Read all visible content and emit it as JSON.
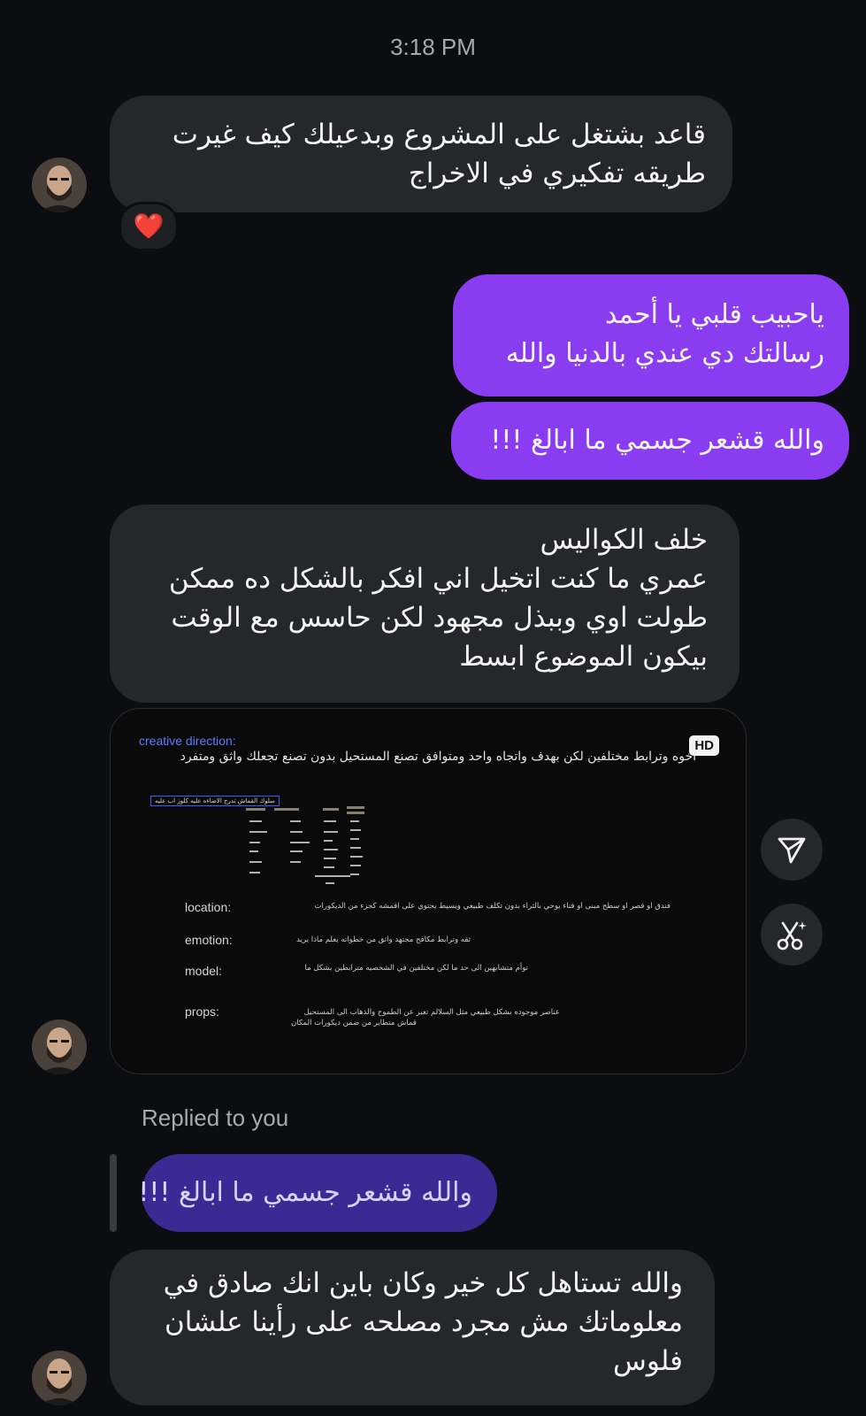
{
  "timestamp": "3:18 PM",
  "messages": [
    {
      "lines": [
        "قاعد بشتغل على المشروع وبدعيلك كيف غيرت",
        "طريقه تفكيري في الاخراج"
      ],
      "reaction": "❤️"
    },
    {
      "lines": [
        "ياحبيب قلبي يا أحمد",
        "رسالتك دي عندي بالدنيا والله"
      ]
    },
    {
      "lines": [
        "والله قشعر جسمي ما ابالغ !!!"
      ]
    },
    {
      "lines": [
        "خلف الكواليس",
        "عمري ما كنت اتخيل اني افكر بالشكل ده ممكن",
        "طولت اوي وببذل مجهود لكن حاسس مع الوقت",
        "بيكون الموضوع ابسط"
      ]
    },
    {
      "lines": [
        "والله تستاهل كل خير وكان باين انك صادق في",
        "معلوماتك مش مجرد مصلحه على رأينا علشان",
        "فلوس"
      ]
    }
  ],
  "media": {
    "badge": "HD",
    "heading": "creative direction:",
    "subheading": "اخوه وترابط مختلفين لكن بهدف واتجاه واحد ومتوافق تصنع المستحيل بدون تصنع تجعلك واثق ومتفرد",
    "chart_caption": "سلوك القماش تدرج الاضاءه عليه كلوز اب عليه",
    "rows": [
      {
        "label": "location:",
        "text": "فندق او قصر او سطح مبنى او فناء يوحي بالثراء بدون تكلف طبيعي وبسيط يحتوي على اقمشه كجزء من الديكورات"
      },
      {
        "label": "emotion:",
        "text": "ثقه وترابط مكافح مجتهد واثق من خطواته يعلم ماذا يريد"
      },
      {
        "label": "model:",
        "text": "توأم متشابهين الى حد ما لكن مختلفين في الشخصيه مترابطين بشكل ما"
      },
      {
        "label": "props:",
        "text": "عناصر موجوده بشكل طبيعي مثل السلالم تعبر عن الطموح والذهاب الى المستحيل",
        "text2": "قماش متطاير من ضمن ديكورات المكان"
      }
    ]
  },
  "reply": {
    "label": "Replied to you",
    "quoted": "والله قشعر جسمي ما ابالغ !!!"
  },
  "icons": {
    "share": "send-icon",
    "edit": "magic-scissors-icon"
  },
  "colors": {
    "background": "#0c0d10",
    "incoming": "#26272c",
    "outgoing": "#8a3df0",
    "quoted": "#3b2a93"
  }
}
